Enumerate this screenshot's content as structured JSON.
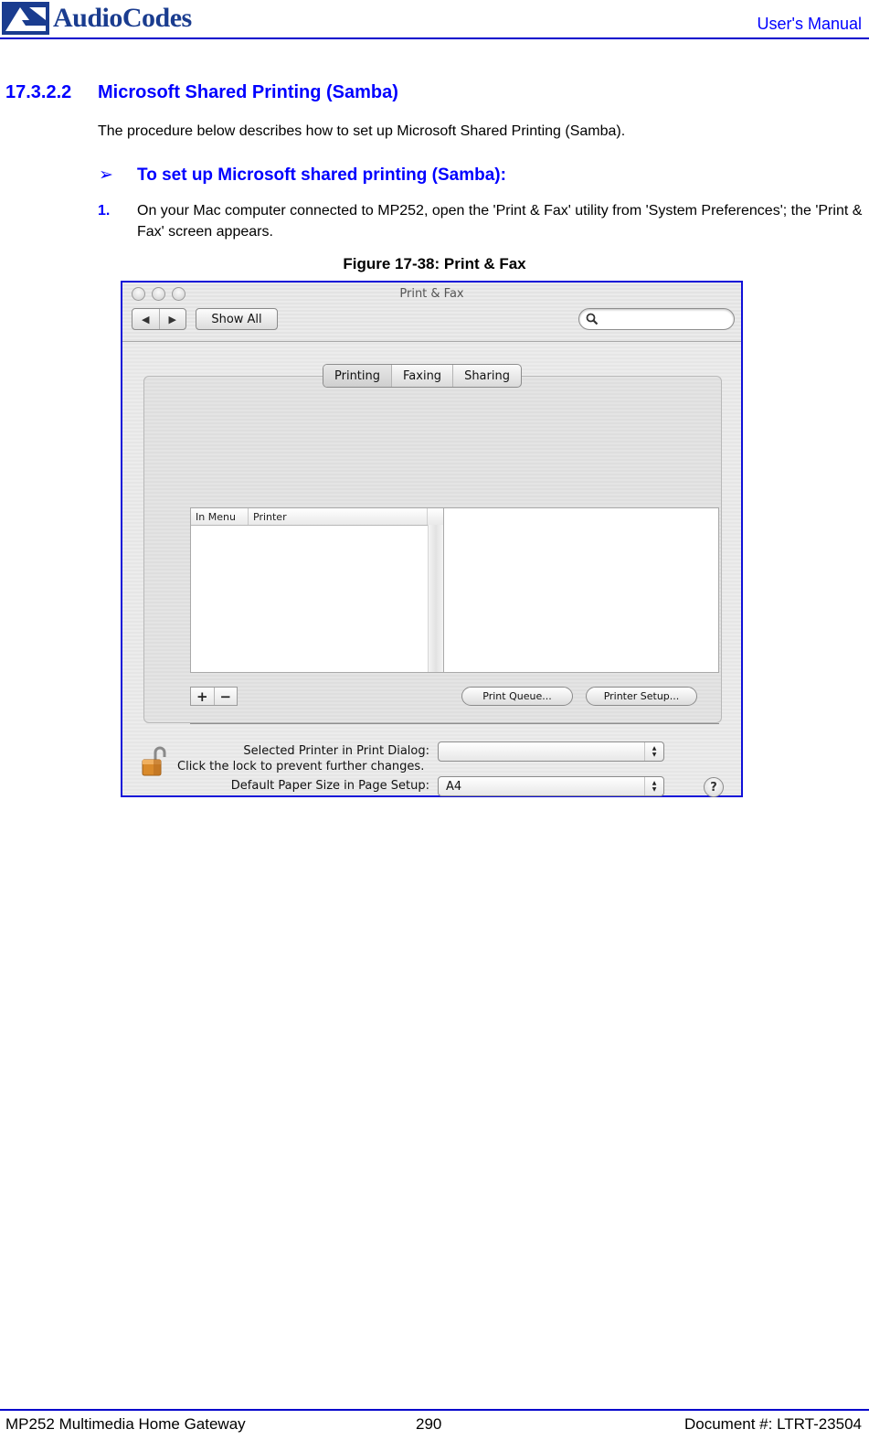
{
  "header": {
    "logo_text": "AudioCodes",
    "logo_icon": "audiocodes-logo-icon",
    "right_title": "User's Manual"
  },
  "section": {
    "number": "17.3.2.2",
    "title": "Microsoft Shared Printing (Samba)",
    "intro": "The procedure below describes how to set up Microsoft Shared Printing (Samba).",
    "procedure_arrow": "➢",
    "procedure_title": "To set up Microsoft shared printing (Samba):",
    "steps": [
      {
        "number": "1.",
        "text": "On your Mac computer connected to MP252, open the 'Print & Fax' utility from 'System Preferences'; the 'Print & Fax' screen appears."
      }
    ],
    "figure_caption": "Figure 17-38: Print & Fax"
  },
  "window": {
    "title": "Print & Fax",
    "nav_back": "◀",
    "nav_forward": "▶",
    "show_all_label": "Show All",
    "search_placeholder": "",
    "search_value": "",
    "tabs": [
      {
        "label": "Printing",
        "active": true
      },
      {
        "label": "Faxing",
        "active": false
      },
      {
        "label": "Sharing",
        "active": false
      }
    ],
    "printer_list": {
      "columns": [
        "In Menu",
        "Printer"
      ],
      "rows": []
    },
    "add_label": "+",
    "remove_label": "−",
    "print_queue_label": "Print Queue...",
    "printer_setup_label": "Printer Setup...",
    "selected_printer": {
      "label": "Selected Printer in Print Dialog:",
      "value": ""
    },
    "paper_size": {
      "label": "Default Paper Size in Page Setup:",
      "value": "A4"
    },
    "help_label": "?",
    "lock_text": "Click the lock to prevent further changes."
  },
  "footer": {
    "left": "MP252 Multimedia Home Gateway",
    "page": "290",
    "right": "Document #: LTRT-23504"
  }
}
